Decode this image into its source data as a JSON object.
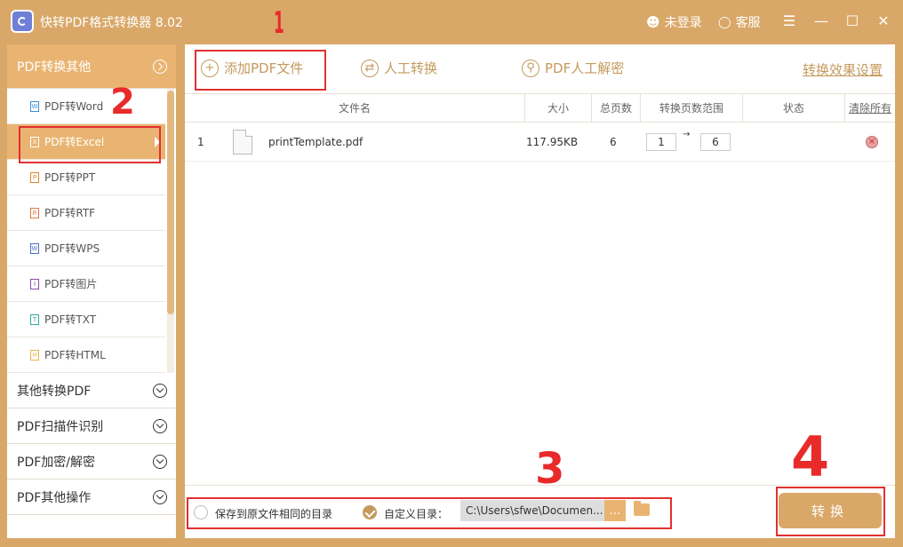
{
  "titlebar": {
    "app_title": "快转PDF格式转换器 8.02",
    "login_label": "未登录",
    "service_label": "客服"
  },
  "sidebar": {
    "active_section": "PDF转换其他",
    "items": [
      {
        "label": "PDF转Word",
        "icon": "W"
      },
      {
        "label": "PDF转Excel",
        "icon": "X"
      },
      {
        "label": "PDF转PPT",
        "icon": "P"
      },
      {
        "label": "PDF转RTF",
        "icon": "R"
      },
      {
        "label": "PDF转WPS",
        "icon": "W"
      },
      {
        "label": "PDF转图片",
        "icon": "I"
      },
      {
        "label": "PDF转TXT",
        "icon": "T"
      },
      {
        "label": "PDF转HTML",
        "icon": "H"
      }
    ],
    "sections": [
      "其他转换PDF",
      "PDF扫描件识别",
      "PDF加密/解密",
      "PDF其他操作"
    ]
  },
  "toolbar": {
    "add_file": "添加PDF文件",
    "manual_convert": "人工转换",
    "manual_decrypt": "PDF人工解密",
    "settings": "转换效果设置"
  },
  "table": {
    "headers": {
      "filename": "文件名",
      "size": "大小",
      "pages": "总页数",
      "range": "转换页数范围",
      "status": "状态",
      "clear_all": "清除所有"
    },
    "rows": [
      {
        "index": "1",
        "filename": "printTemplate.pdf",
        "size": "117.95KB",
        "pages": "6",
        "from": "1",
        "arrow": "→",
        "to": "6"
      }
    ]
  },
  "bottom": {
    "save_same_dir": "保存到原文件相同的目录",
    "custom_dir": "自定义目录：",
    "path": "C:\\Users\\sfwe\\Documen...",
    "browse": "...",
    "convert": "转换"
  },
  "annotations": [
    "1",
    "2",
    "3",
    "4"
  ],
  "colors": {
    "accent": "#d9a868",
    "accent_light": "#e9b472",
    "accent_text": "#c49a5c",
    "annotation_red": "#e23030"
  }
}
